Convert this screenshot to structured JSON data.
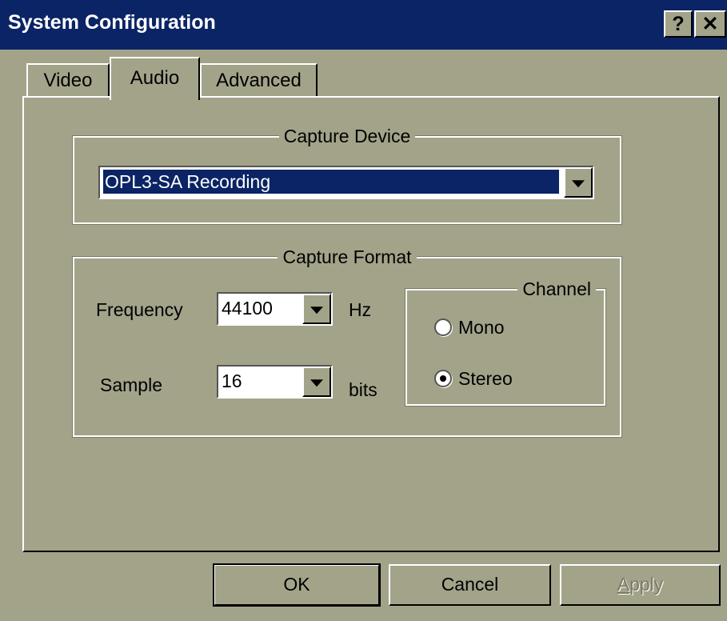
{
  "window": {
    "title": "System Configuration",
    "help_button": "?",
    "close_button": "✕"
  },
  "tabs": [
    {
      "label": "Video",
      "active": false
    },
    {
      "label": "Audio",
      "active": true
    },
    {
      "label": "Advanced",
      "active": false
    }
  ],
  "capture_device": {
    "group_title": "Capture Device",
    "selected": "OPL3-SA Recording"
  },
  "capture_format": {
    "group_title": "Capture Format",
    "frequency": {
      "label": "Frequency",
      "value": "44100",
      "unit": "Hz"
    },
    "sample": {
      "label": "Sample",
      "value": "16",
      "unit": "bits"
    },
    "channel": {
      "group_title": "Channel",
      "options": [
        {
          "label": "Mono",
          "selected": false
        },
        {
          "label": "Stereo",
          "selected": true
        }
      ]
    }
  },
  "buttons": {
    "ok": "OK",
    "cancel": "Cancel",
    "apply_first": "A",
    "apply_rest": "pply"
  },
  "colors": {
    "face": "#a3a38a",
    "titlebar": "#0a2465",
    "selection": "#0a2465"
  }
}
